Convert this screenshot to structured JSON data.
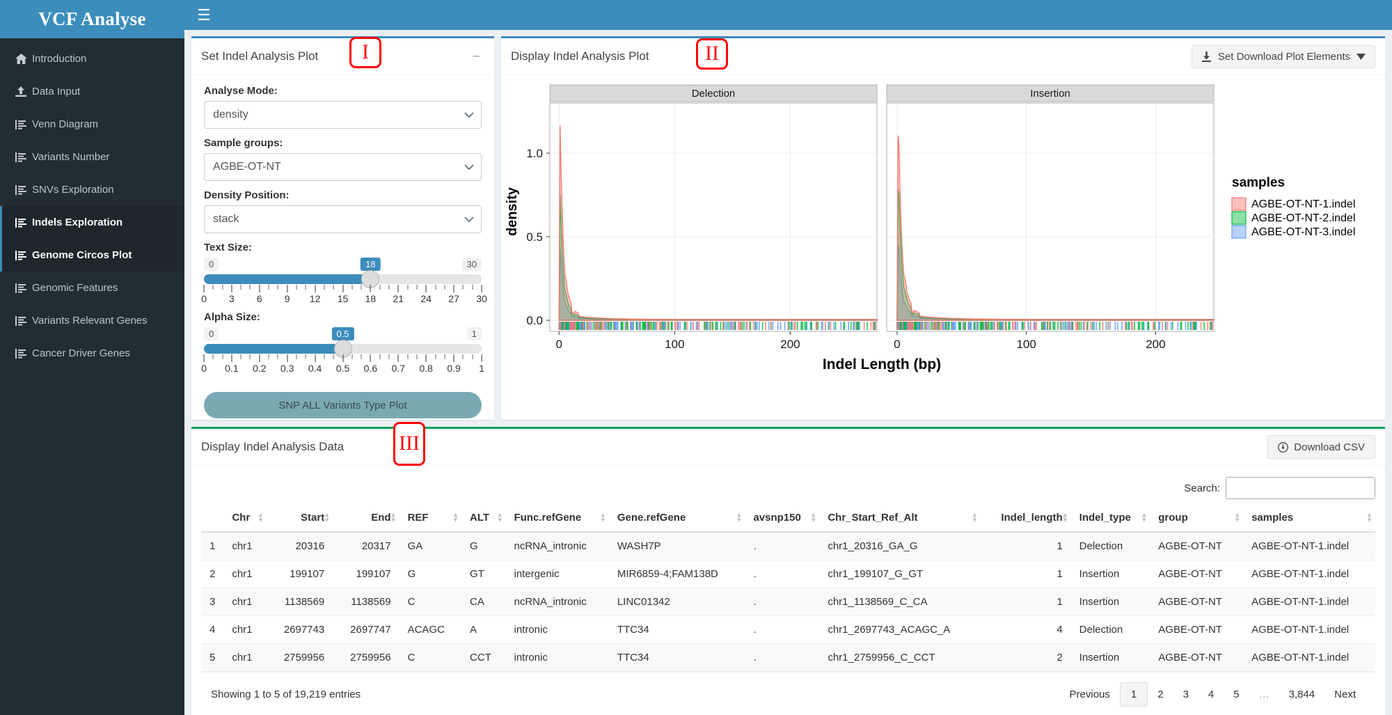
{
  "brand": {
    "title": "VCF Analyse"
  },
  "topbar": {
    "menu_icon": "hamburger-icon"
  },
  "sidebar": {
    "items": [
      {
        "label": "Introduction",
        "icon": "home-icon",
        "active": false
      },
      {
        "label": "Data Input",
        "icon": "upload-icon",
        "active": false
      },
      {
        "label": "Venn Diagram",
        "icon": "chart-bars-icon",
        "active": false
      },
      {
        "label": "Variants Number",
        "icon": "chart-bars-icon",
        "active": false
      },
      {
        "label": "SNVs Exploration",
        "icon": "chart-bars-icon",
        "active": false
      },
      {
        "label": "Indels Exploration",
        "icon": "chart-bars-icon",
        "active": true
      },
      {
        "label": "Genome Circos Plot",
        "icon": "chart-bars-icon",
        "active": false
      },
      {
        "label": "Genomic Features",
        "icon": "chart-bars-icon",
        "active": false
      },
      {
        "label": "Variants Relevant Genes",
        "icon": "chart-bars-icon",
        "active": false
      },
      {
        "label": "Cancer Driver Genes",
        "icon": "chart-bars-icon",
        "active": false
      }
    ]
  },
  "panel_settings": {
    "title": "Set Indel Analysis Plot",
    "marker": "I",
    "collapse_label": "−",
    "analyse_mode": {
      "label": "Analyse Mode:",
      "value": "density"
    },
    "sample_groups": {
      "label": "Sample groups:",
      "value": "AGBE-OT-NT"
    },
    "density_position": {
      "label": "Density Position:",
      "value": "stack"
    },
    "text_size": {
      "label": "Text Size:",
      "min": "0",
      "max": "30",
      "value": "18",
      "ticks": [
        "0",
        "3",
        "6",
        "9",
        "12",
        "15",
        "18",
        "21",
        "24",
        "27",
        "30"
      ]
    },
    "alpha_size": {
      "label": "Alpha Size:",
      "min": "0",
      "max": "1",
      "value": "0.5",
      "ticks": [
        "0",
        "0.1",
        "0.2",
        "0.3",
        "0.4",
        "0.5",
        "0.6",
        "0.7",
        "0.8",
        "0.9",
        "1"
      ]
    },
    "snp_button": "SNP ALL Variants Type Plot"
  },
  "panel_plot": {
    "title": "Display Indel Analysis Plot",
    "marker": "II",
    "download_button": "Set Download Plot Elements",
    "download_icon": "download-icon",
    "caret_icon": "caret-down-icon"
  },
  "chart_data": {
    "type": "line",
    "title": "",
    "xlabel": "Indel Length (bp)",
    "ylabel": "density",
    "facets": [
      "Delection",
      "Insertion"
    ],
    "ylim": [
      0,
      1.3
    ],
    "yticks": [
      "0.0",
      "0.5",
      "1.0"
    ],
    "ytickvals": [
      0.0,
      0.5,
      1.0
    ],
    "xticks_delection": [
      "0",
      "100",
      "200"
    ],
    "xtickvals_delection": [
      0,
      100,
      200
    ],
    "xlim_delection": [
      -8,
      275
    ],
    "xticks_insertion": [
      "0",
      "100",
      "200"
    ],
    "xtickvals_insertion": [
      0,
      100,
      200
    ],
    "xlim_insertion": [
      -8,
      245
    ],
    "grid": true,
    "legend_title": "samples",
    "legend_position": "right",
    "series": [
      {
        "name": "AGBE-OT-NT-1.indel",
        "color": "#F8766D",
        "peak_delection": 1.22,
        "peak_insertion": 1.3
      },
      {
        "name": "AGBE-OT-NT-2.indel",
        "color": "#00BA38",
        "peak_delection": 0.79,
        "peak_insertion": 0.92
      },
      {
        "name": "AGBE-OT-NT-3.indel",
        "color": "#619CFF",
        "peak_delection": 0.46,
        "peak_insertion": 0.53
      }
    ]
  },
  "panel_table": {
    "title": "Display Indel Analysis Data",
    "marker": "III",
    "download_csv": "Download CSV",
    "download_csv_icon": "download-circle-icon",
    "search_label": "Search:",
    "search_value": "",
    "search_placeholder": "",
    "columns": [
      {
        "key": "idx",
        "label": "",
        "align": "lft"
      },
      {
        "key": "chr",
        "label": "Chr",
        "align": "lft"
      },
      {
        "key": "start",
        "label": "Start",
        "align": "num"
      },
      {
        "key": "end",
        "label": "End",
        "align": "num"
      },
      {
        "key": "ref",
        "label": "REF",
        "align": "lft"
      },
      {
        "key": "alt",
        "label": "ALT",
        "align": "lft"
      },
      {
        "key": "func",
        "label": "Func.refGene",
        "align": "lft"
      },
      {
        "key": "gene",
        "label": "Gene.refGene",
        "align": "lft"
      },
      {
        "key": "avsnp",
        "label": "avsnp150",
        "align": "lft"
      },
      {
        "key": "csra",
        "label": "Chr_Start_Ref_Alt",
        "align": "lft"
      },
      {
        "key": "ilen",
        "label": "Indel_length",
        "align": "num"
      },
      {
        "key": "itype",
        "label": "Indel_type",
        "align": "lft"
      },
      {
        "key": "group",
        "label": "group",
        "align": "lft"
      },
      {
        "key": "samples",
        "label": "samples",
        "align": "lft"
      }
    ],
    "rows": [
      {
        "idx": "1",
        "chr": "chr1",
        "start": "20316",
        "end": "20317",
        "ref": "GA",
        "alt": "G",
        "func": "ncRNA_intronic",
        "gene": "WASH7P",
        "avsnp": ".",
        "csra": "chr1_20316_GA_G",
        "ilen": "1",
        "itype": "Delection",
        "group": "AGBE-OT-NT",
        "samples": "AGBE-OT-NT-1.indel"
      },
      {
        "idx": "2",
        "chr": "chr1",
        "start": "199107",
        "end": "199107",
        "ref": "G",
        "alt": "GT",
        "func": "intergenic",
        "gene": "MIR6859-4;FAM138D",
        "avsnp": ".",
        "csra": "chr1_199107_G_GT",
        "ilen": "1",
        "itype": "Insertion",
        "group": "AGBE-OT-NT",
        "samples": "AGBE-OT-NT-1.indel"
      },
      {
        "idx": "3",
        "chr": "chr1",
        "start": "1138569",
        "end": "1138569",
        "ref": "C",
        "alt": "CA",
        "func": "ncRNA_intronic",
        "gene": "LINC01342",
        "avsnp": ".",
        "csra": "chr1_1138569_C_CA",
        "ilen": "1",
        "itype": "Insertion",
        "group": "AGBE-OT-NT",
        "samples": "AGBE-OT-NT-1.indel"
      },
      {
        "idx": "4",
        "chr": "chr1",
        "start": "2697743",
        "end": "2697747",
        "ref": "ACAGC",
        "alt": "A",
        "func": "intronic",
        "gene": "TTC34",
        "avsnp": ".",
        "csra": "chr1_2697743_ACAGC_A",
        "ilen": "4",
        "itype": "Delection",
        "group": "AGBE-OT-NT",
        "samples": "AGBE-OT-NT-1.indel"
      },
      {
        "idx": "5",
        "chr": "chr1",
        "start": "2759956",
        "end": "2759956",
        "ref": "C",
        "alt": "CCT",
        "func": "intronic",
        "gene": "TTC34",
        "avsnp": ".",
        "csra": "chr1_2759956_C_CCT",
        "ilen": "2",
        "itype": "Insertion",
        "group": "AGBE-OT-NT",
        "samples": "AGBE-OT-NT-1.indel"
      }
    ],
    "footer_info": "Showing 1 to 5 of 19,219 entries",
    "pager": {
      "previous": "Previous",
      "pages": [
        "1",
        "2",
        "3",
        "4",
        "5",
        "…",
        "3,844"
      ],
      "current": "1",
      "next": "Next"
    }
  },
  "colors": {
    "brand_blue": "#3c8dbc",
    "sidebar_dark": "#222d32",
    "accent_green": "#00a65a",
    "marker_red": "#ff0000",
    "series_red": "#F8766D",
    "series_green": "#00BA38",
    "series_blue": "#619CFF"
  }
}
